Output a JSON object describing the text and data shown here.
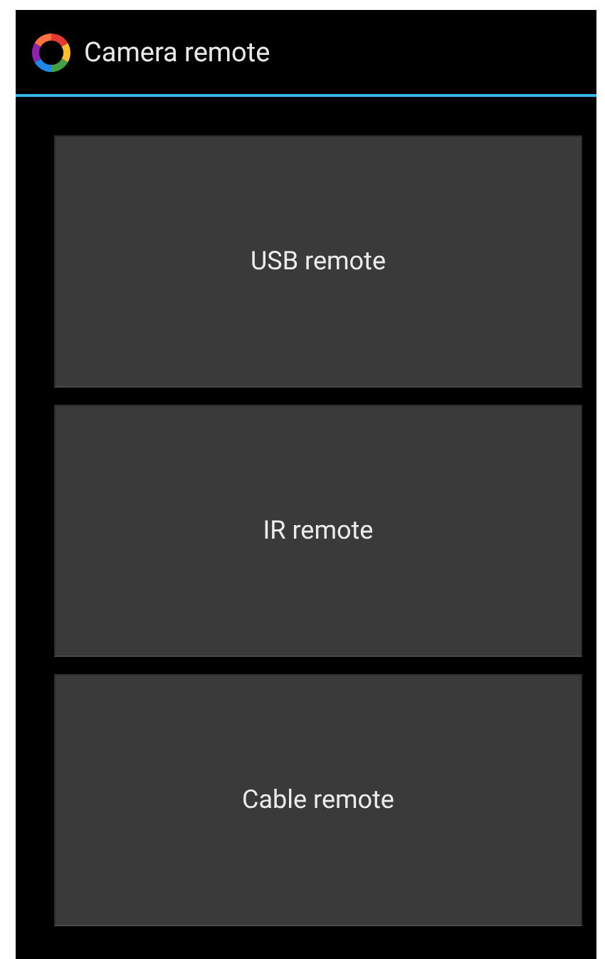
{
  "action_bar": {
    "title": "Camera remote"
  },
  "buttons": [
    {
      "label": "USB remote"
    },
    {
      "label": "IR remote"
    },
    {
      "label": "Cable remote"
    }
  ]
}
